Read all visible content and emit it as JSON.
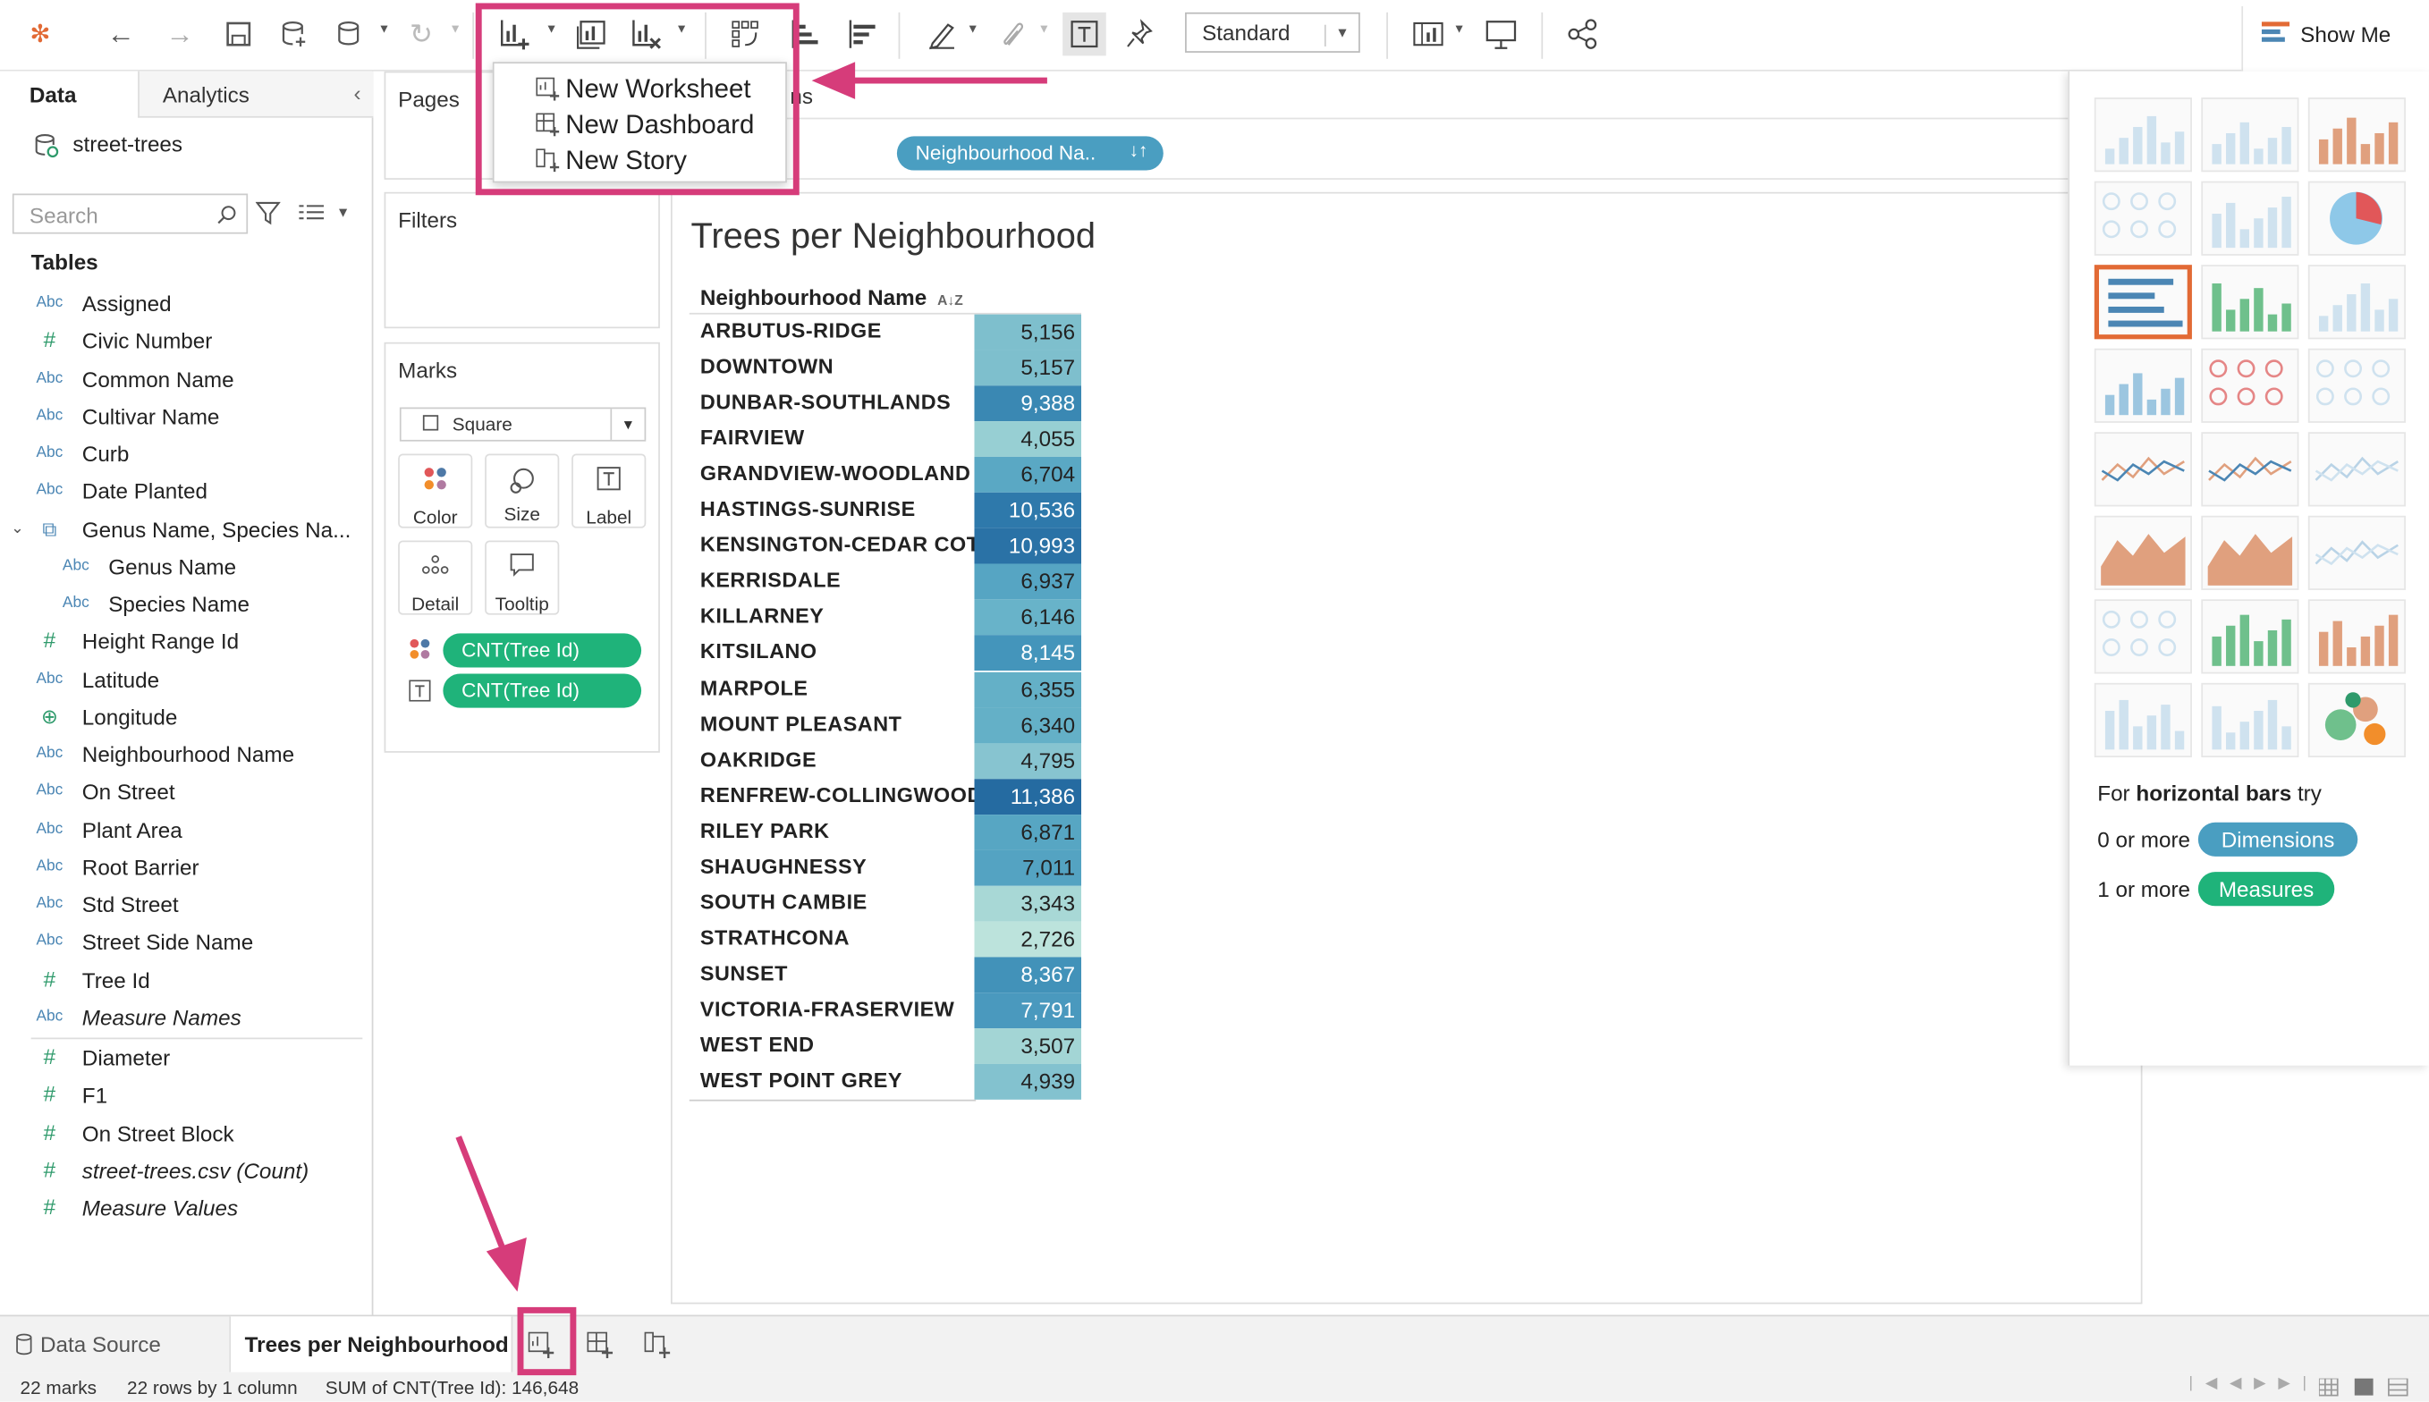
{
  "toolbar": {
    "view_mode": "Standard",
    "show_me_label": "Show Me"
  },
  "new_sheet_menu": {
    "items": [
      "New Worksheet",
      "New Dashboard",
      "New Story"
    ]
  },
  "sidebar": {
    "tabs": [
      "Data",
      "Analytics"
    ],
    "datasource": "street-trees",
    "search_placeholder": "Search",
    "tables_heading": "Tables",
    "fields": [
      {
        "icon": "Abc",
        "name": "Assigned"
      },
      {
        "icon": "#",
        "name": "Civic Number"
      },
      {
        "icon": "Abc",
        "name": "Common Name"
      },
      {
        "icon": "Abc",
        "name": "Cultivar Name"
      },
      {
        "icon": "Abc",
        "name": "Curb"
      },
      {
        "icon": "Abc",
        "name": "Date Planted"
      },
      {
        "icon": "hierarchy",
        "name": "Genus Name, Species Na..."
      },
      {
        "icon": "Abc",
        "name": "Genus Name",
        "indent": true
      },
      {
        "icon": "Abc",
        "name": "Species Name",
        "indent": true
      },
      {
        "icon": "#",
        "name": "Height Range Id"
      },
      {
        "icon": "Abc",
        "name": "Latitude"
      },
      {
        "icon": "globe",
        "name": "Longitude"
      },
      {
        "icon": "Abc",
        "name": "Neighbourhood Name"
      },
      {
        "icon": "Abc",
        "name": "On Street"
      },
      {
        "icon": "Abc",
        "name": "Plant Area"
      },
      {
        "icon": "Abc",
        "name": "Root Barrier"
      },
      {
        "icon": "Abc",
        "name": "Std Street"
      },
      {
        "icon": "Abc",
        "name": "Street Side Name"
      },
      {
        "icon": "#",
        "name": "Tree Id"
      },
      {
        "icon": "Abc",
        "name": "Measure Names",
        "italic": true
      }
    ],
    "measures": [
      {
        "icon": "#",
        "name": "Diameter"
      },
      {
        "icon": "#",
        "name": "F1"
      },
      {
        "icon": "#",
        "name": "On Street Block"
      },
      {
        "icon": "#",
        "name": "street-trees.csv (Count)",
        "italic": true
      },
      {
        "icon": "#",
        "name": "Measure Values",
        "italic": true
      }
    ]
  },
  "shelves": {
    "pages": "Pages",
    "columns_fragment": "ns",
    "filters": "Filters",
    "marks": "Marks",
    "mark_type": "Square",
    "mark_buttons": [
      "Color",
      "Size",
      "Label",
      "Detail",
      "Tooltip"
    ],
    "mark_pills": [
      "CNT(Tree Id)",
      "CNT(Tree Id)"
    ],
    "rows_pill": "Neighbourhood Na.."
  },
  "worksheet": {
    "title": "Trees per Neighbourhood",
    "column_header": "Neighbourhood Name",
    "rows": [
      {
        "name": "ARBUTUS-RIDGE",
        "value": "5,156",
        "color": "#7ebfcd"
      },
      {
        "name": "DOWNTOWN",
        "value": "5,157",
        "color": "#7ebfcd"
      },
      {
        "name": "DUNBAR-SOUTHLANDS",
        "value": "9,388",
        "color": "#3a88b3"
      },
      {
        "name": "FAIRVIEW",
        "value": "4,055",
        "color": "#97cfd3"
      },
      {
        "name": "GRANDVIEW-WOODLAND",
        "value": "6,704",
        "color": "#5aa8c4"
      },
      {
        "name": "HASTINGS-SUNRISE",
        "value": "10,536",
        "color": "#2e79ab"
      },
      {
        "name": "KENSINGTON-CEDAR COT..",
        "value": "10,993",
        "color": "#2a72a6"
      },
      {
        "name": "KERRISDALE",
        "value": "6,937",
        "color": "#56a5c3"
      },
      {
        "name": "KILLARNEY",
        "value": "6,146",
        "color": "#68b3c9"
      },
      {
        "name": "KITSILANO",
        "value": "8,145",
        "color": "#4495bb"
      },
      {
        "name": "MARPOLE",
        "value": "6,355",
        "color": "#64b0c7"
      },
      {
        "name": "MOUNT PLEASANT",
        "value": "6,340",
        "color": "#64b0c7"
      },
      {
        "name": "OAKRIDGE",
        "value": "4,795",
        "color": "#87c4d0"
      },
      {
        "name": "RENFREW-COLLINGWOOD",
        "value": "11,386",
        "color": "#256ba1"
      },
      {
        "name": "RILEY PARK",
        "value": "6,871",
        "color": "#57a6c3"
      },
      {
        "name": "SHAUGHNESSY",
        "value": "7,011",
        "color": "#54a3c2"
      },
      {
        "name": "SOUTH CAMBIE",
        "value": "3,343",
        "color": "#a8d8d6"
      },
      {
        "name": "STRATHCONA",
        "value": "2,726",
        "color": "#bce3dc"
      },
      {
        "name": "SUNSET",
        "value": "8,367",
        "color": "#4292b9"
      },
      {
        "name": "VICTORIA-FRASERVIEW",
        "value": "7,791",
        "color": "#4a99be"
      },
      {
        "name": "WEST END",
        "value": "3,507",
        "color": "#a3d5d5"
      },
      {
        "name": "WEST POINT GREY",
        "value": "4,939",
        "color": "#83c2cf"
      }
    ]
  },
  "show_me": {
    "hint_prefix": "For",
    "hint_bold": "horizontal bars",
    "hint_suffix": "try",
    "req1_text": "0 or more",
    "req1_pill": "Dimensions",
    "req2_text": "1 or more",
    "req2_pill": "Measures"
  },
  "bottom_tabs": {
    "data_source": "Data Source",
    "active_sheet": "Trees per Neighbourhood"
  },
  "status_bar": {
    "marks": "22 marks",
    "rows_cols": "22 rows by 1 column",
    "sum": "SUM of CNT(Tree Id): 146,648"
  },
  "colors": {
    "accent_pink": "#d63c7a",
    "pill_green": "#1fb37a",
    "pill_blue": "#4a9ec1",
    "selected_thumb": "#e26a35"
  }
}
